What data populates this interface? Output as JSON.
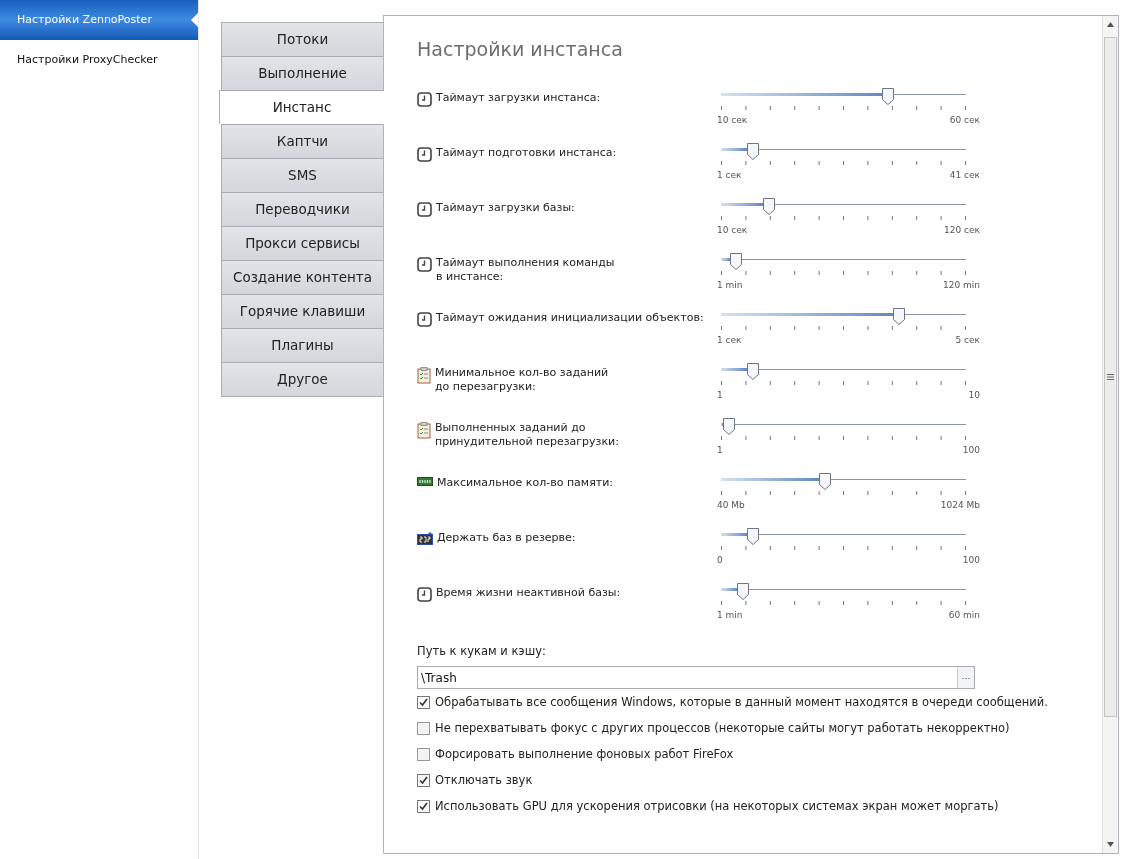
{
  "sidebar": {
    "items": [
      {
        "label": "Настройки ZennoPoster",
        "selected": true
      },
      {
        "label": "Настройки ProxyChecker",
        "selected": false
      }
    ]
  },
  "tabs": [
    {
      "label": "Потоки",
      "selected": false
    },
    {
      "label": "Выполнение",
      "selected": false
    },
    {
      "label": "Инстанс",
      "selected": true
    },
    {
      "label": "Каптчи",
      "selected": false
    },
    {
      "label": "SMS",
      "selected": false
    },
    {
      "label": "Переводчики",
      "selected": false
    },
    {
      "label": "Прокси сервисы",
      "selected": false
    },
    {
      "label": "Создание контента",
      "selected": false
    },
    {
      "label": "Горячие клавиши",
      "selected": false
    },
    {
      "label": "Плагины",
      "selected": false
    },
    {
      "label": "Другое",
      "selected": false
    }
  ],
  "panel": {
    "title": "Настройки инстанса",
    "settings": [
      {
        "kind": "clock",
        "label": "Таймаут загрузки инстанса:",
        "level": 0.69,
        "min": "10 сек",
        "max": "60 сек"
      },
      {
        "kind": "clock",
        "label": "Таймаут подготовки инстанса:",
        "level": 0.11,
        "min": "1 сек",
        "max": "41 сек"
      },
      {
        "kind": "clock",
        "label": "Таймаут загрузки базы:",
        "level": 0.18,
        "min": "10 сек",
        "max": "120 сек"
      },
      {
        "kind": "clock",
        "label": "Таймаут выполнения команды\nв инстансе:",
        "level": 0.04,
        "min": "1 min",
        "max": "120 min"
      },
      {
        "kind": "clock",
        "label": "Таймаут ожидания инициализации объектов:",
        "level": 0.74,
        "min": "1 сек",
        "max": "5 сек"
      },
      {
        "kind": "clipboard",
        "label": "Минимальное кол-во заданий\nдо перезагрузки:",
        "level": 0.11,
        "min": "1",
        "max": "10"
      },
      {
        "kind": "clipboard",
        "label": "Выполненных заданий до\nпринудительной перезагрузки:",
        "level": 0.01,
        "min": "1",
        "max": "100"
      },
      {
        "kind": "memory",
        "label": "Максимальное кол-во памяти:",
        "level": 0.42,
        "min": "40 Mb",
        "max": "1024 Mb"
      },
      {
        "kind": "counter",
        "label": "Держать баз в резерве:",
        "level": 0.11,
        "min": "0",
        "max": "100"
      },
      {
        "kind": "clock",
        "label": "Время жизни неактивной базы:",
        "level": 0.07,
        "min": "1 min",
        "max": "60 min"
      }
    ],
    "path_label": "Путь к кукам и кэшу:",
    "path_value": "\\Trash",
    "browse_button": "···",
    "options": [
      {
        "label": "Обрабатывать все сообщения Windows, которые в данный момент находятся в очереди сообщений.",
        "checked": true
      },
      {
        "label": "Не перехватывать фокус с других процессов (некоторые сайты могут работать некорректно)",
        "checked": false
      },
      {
        "label": "Форсировать выполнение фоновых работ FireFox",
        "checked": false
      },
      {
        "label": "Отключать звук",
        "checked": true
      },
      {
        "label": "Использовать GPU для ускорения отрисовки (на некоторых системах экран может моргать)",
        "checked": true
      }
    ]
  }
}
